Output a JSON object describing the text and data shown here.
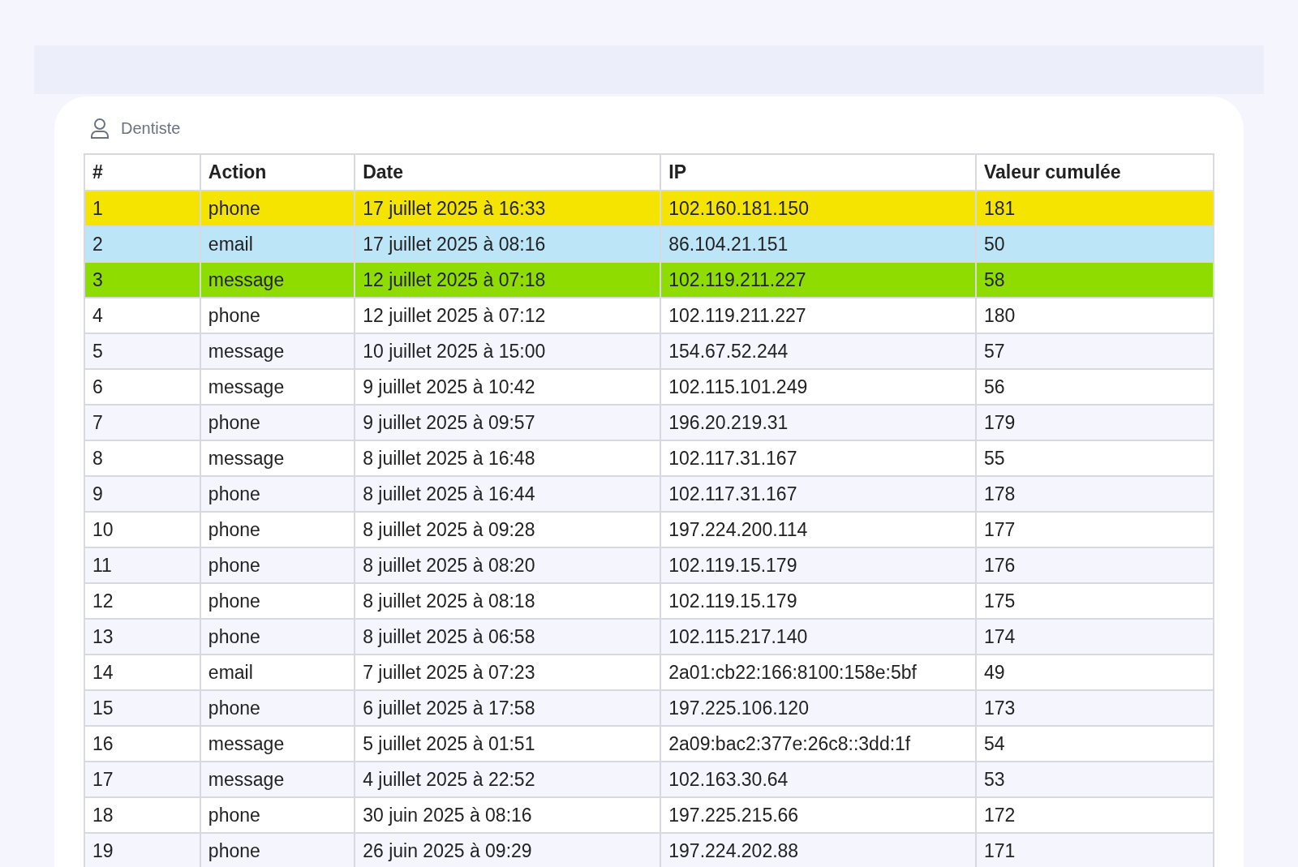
{
  "card": {
    "title": "Dentiste"
  },
  "table": {
    "columns": [
      "#",
      "Action",
      "Date",
      "IP",
      "Valeur cumulée"
    ],
    "rows": [
      {
        "cells": [
          "1",
          "phone",
          "17 juillet 2025 à 16:33",
          "102.160.181.150",
          "181"
        ],
        "color": "#f5e400"
      },
      {
        "cells": [
          "2",
          "email",
          "17 juillet 2025 à 08:16",
          "86.104.21.151",
          "50"
        ],
        "color": "#bde5f8"
      },
      {
        "cells": [
          "3",
          "message",
          "12 juillet 2025 à 07:18",
          "102.119.211.227",
          "58"
        ],
        "color": "#8fdc00"
      },
      {
        "cells": [
          "4",
          "phone",
          "12 juillet 2025 à 07:12",
          "102.119.211.227",
          "180"
        ]
      },
      {
        "cells": [
          "5",
          "message",
          "10 juillet 2025 à 15:00",
          "154.67.52.244",
          "57"
        ]
      },
      {
        "cells": [
          "6",
          "message",
          "9 juillet 2025 à 10:42",
          "102.115.101.249",
          "56"
        ]
      },
      {
        "cells": [
          "7",
          "phone",
          "9 juillet 2025 à 09:57",
          "196.20.219.31",
          "179"
        ]
      },
      {
        "cells": [
          "8",
          "message",
          "8 juillet 2025 à 16:48",
          "102.117.31.167",
          "55"
        ]
      },
      {
        "cells": [
          "9",
          "phone",
          "8 juillet 2025 à 16:44",
          "102.117.31.167",
          "178"
        ]
      },
      {
        "cells": [
          "10",
          "phone",
          "8 juillet 2025 à 09:28",
          "197.224.200.114",
          "177"
        ]
      },
      {
        "cells": [
          "11",
          "phone",
          "8 juillet 2025 à 08:20",
          "102.119.15.179",
          "176"
        ]
      },
      {
        "cells": [
          "12",
          "phone",
          "8 juillet 2025 à 08:18",
          "102.119.15.179",
          "175"
        ]
      },
      {
        "cells": [
          "13",
          "phone",
          "8 juillet 2025 à 06:58",
          "102.115.217.140",
          "174"
        ]
      },
      {
        "cells": [
          "14",
          "email",
          "7 juillet 2025 à 07:23",
          "2a01:cb22:166:8100:158e:5bf",
          "49"
        ]
      },
      {
        "cells": [
          "15",
          "phone",
          "6 juillet 2025 à 17:58",
          "197.225.106.120",
          "173"
        ]
      },
      {
        "cells": [
          "16",
          "message",
          "5 juillet 2025 à 01:51",
          "2a09:bac2:377e:26c8::3dd:1f",
          "54"
        ]
      },
      {
        "cells": [
          "17",
          "message",
          "4 juillet 2025 à 22:52",
          "102.163.30.64",
          "53"
        ]
      },
      {
        "cells": [
          "18",
          "phone",
          "30 juin 2025 à 08:16",
          "197.225.215.66",
          "172"
        ]
      },
      {
        "cells": [
          "19",
          "phone",
          "26 juin 2025 à 09:29",
          "197.224.202.88",
          "171"
        ]
      }
    ]
  }
}
